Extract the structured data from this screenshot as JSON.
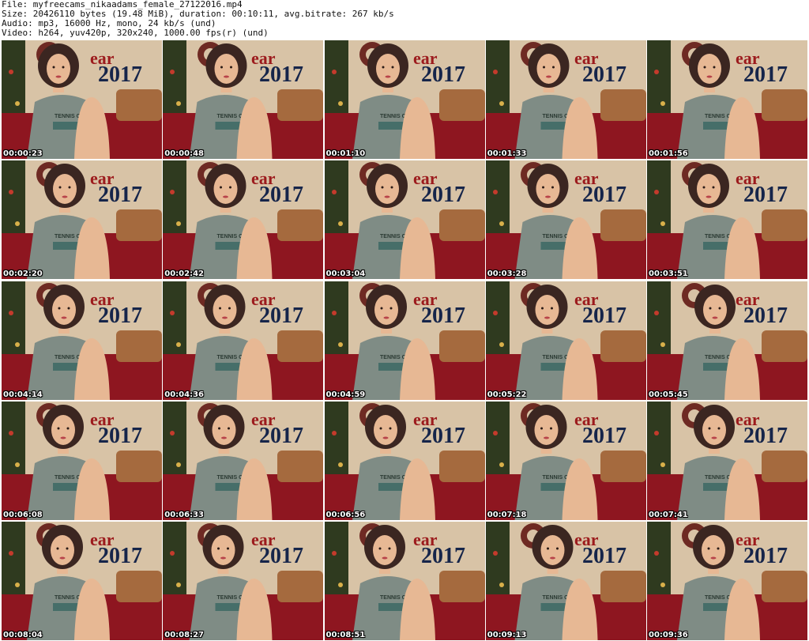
{
  "header": {
    "file": "File: myfreecams_nikaadams_female_27122016.mp4",
    "size": "Size: 20426110 bytes (19.48 MiB), duration: 00:10:11, avg.bitrate: 267 kb/s",
    "audio": "Audio: mp3, 16000 Hz, mono, 24 kb/s (und)",
    "video": "Video: h264, yuv420p, 320x240, 1000.00 fps(r) (und)"
  },
  "frames": [
    {
      "timestamp": "00:00:23",
      "banner": "2017",
      "banner_left": "ear",
      "shirt_text": "TENNIS C"
    },
    {
      "timestamp": "00:00:48",
      "banner": "2017",
      "banner_left": "ear",
      "shirt_text": "TENNIS C"
    },
    {
      "timestamp": "00:01:10",
      "banner": "2017",
      "banner_left": "ear",
      "shirt_text": "TENNIS C"
    },
    {
      "timestamp": "00:01:33",
      "banner": "2017",
      "banner_left": "ear",
      "shirt_text": "TENNIS C"
    },
    {
      "timestamp": "00:01:56",
      "banner": "2017",
      "banner_left": "ear",
      "shirt_text": "TENNIS C"
    },
    {
      "timestamp": "00:02:20",
      "banner": "2017",
      "banner_left": "ear",
      "shirt_text": "TENNIS C"
    },
    {
      "timestamp": "00:02:42",
      "banner": "2017",
      "banner_left": "ear",
      "shirt_text": "TENNIS C"
    },
    {
      "timestamp": "00:03:04",
      "banner": "2017",
      "banner_left": "ear",
      "shirt_text": "TENNIS C"
    },
    {
      "timestamp": "00:03:28",
      "banner": "2017",
      "banner_left": "ear",
      "shirt_text": "TENNIS C"
    },
    {
      "timestamp": "00:03:51",
      "banner": "2017",
      "banner_left": "ear",
      "shirt_text": "TENNIS C"
    },
    {
      "timestamp": "00:04:14",
      "banner": "2017",
      "banner_left": "ear",
      "shirt_text": "TENNIS C"
    },
    {
      "timestamp": "00:04:36",
      "banner": "2017",
      "banner_left": "ear",
      "shirt_text": "TENNIS C"
    },
    {
      "timestamp": "00:04:59",
      "banner": "2017",
      "banner_left": "ear",
      "shirt_text": "TENNIS C"
    },
    {
      "timestamp": "00:05:22",
      "banner": "2017",
      "banner_left": "ear",
      "shirt_text": "TENNIS C"
    },
    {
      "timestamp": "00:05:45",
      "banner": "2017",
      "banner_left": "ear",
      "shirt_text": "TENNIS C"
    },
    {
      "timestamp": "00:06:08",
      "banner": "2017",
      "banner_left": "ear",
      "shirt_text": "TENNIS C"
    },
    {
      "timestamp": "00:06:33",
      "banner": "2017",
      "banner_left": "ear",
      "shirt_text": "TENNIS C"
    },
    {
      "timestamp": "00:06:56",
      "banner": "2017",
      "banner_left": "ear",
      "shirt_text": "TENNIS C"
    },
    {
      "timestamp": "00:07:18",
      "banner": "2017",
      "banner_left": "ear",
      "shirt_text": "TENNIS C"
    },
    {
      "timestamp": "00:07:41",
      "banner": "2017",
      "banner_left": "ear",
      "shirt_text": "TENNIS C"
    },
    {
      "timestamp": "00:08:04",
      "banner": "2017",
      "banner_left": "ear",
      "shirt_text": "TENNIS C"
    },
    {
      "timestamp": "00:08:27",
      "banner": "2017",
      "banner_left": "ear",
      "shirt_text": "TENNIS C"
    },
    {
      "timestamp": "00:08:51",
      "banner": "2017",
      "banner_left": "ear",
      "shirt_text": "TENNIS C"
    },
    {
      "timestamp": "00:09:13",
      "banner": "2017",
      "banner_left": "ear",
      "shirt_text": "TENNIS C"
    },
    {
      "timestamp": "00:09:36",
      "banner": "2017",
      "banner_left": "ear",
      "shirt_text": "TENNIS C"
    }
  ],
  "colors": {
    "wall": "#d8c3a6",
    "sofa": "#8e1620",
    "sweater": "#7f8c85",
    "skin": "#e7b894",
    "hair": "#3b2621",
    "banner_text": "#16254a",
    "banner_red": "#9c1b1d",
    "tree": "#2f3a1f"
  }
}
